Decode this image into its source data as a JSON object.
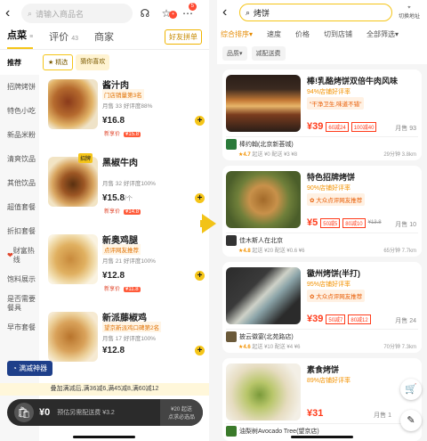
{
  "left": {
    "search_placeholder": "请输入商品名",
    "badge": "5",
    "tabs": [
      {
        "label": "点菜"
      },
      {
        "label": "评价",
        "count": "43"
      },
      {
        "label": "商家"
      }
    ],
    "friend_btn": "好友拼单",
    "chips": [
      "精选",
      "猜你喜欢"
    ],
    "sidebar": [
      "推荐",
      "招牌烤饼",
      "特色小吃",
      "新品米粉",
      "清爽饮品",
      "其他饮品",
      "超值套餐",
      "折扣套餐",
      "财富热线",
      "饱料展示",
      "是否需要餐具",
      "早市套餐"
    ],
    "items": [
      {
        "name": "酱汁肉",
        "rank": "门店销量第3名",
        "sales": "月售 33 好评度88%",
        "price": "¥16.8",
        "unit": "",
        "disc": "新享价",
        "disc_val": "¥15.8"
      },
      {
        "name": "黑椒牛肉",
        "rank": "",
        "sales": "月售 32 好评度100%",
        "price": "¥15.8",
        "unit": "/个",
        "disc": "新享价",
        "disc_val": "¥14.8",
        "tag": "招牌"
      },
      {
        "name": "新奥鸡腿",
        "rank": "点评网友推荐",
        "sales": "月售 21 好评度100%",
        "price": "¥12.8",
        "unit": "",
        "disc": "新享价",
        "disc_val": "¥11.8"
      },
      {
        "name": "新派藤椒鸡",
        "rank": "望京新派鸡口碑第2名",
        "sales": "月售 17 好评度100%",
        "price": "¥12.8",
        "unit": "",
        "disc": "",
        "disc_val": ""
      }
    ],
    "manjian": "满减神器",
    "promo": "叠加满减后,满36减6,满45减8,满60减12",
    "cart": {
      "total": "¥0",
      "fee": "预估另需配送费 ¥3.2",
      "min1": "¥20 起送",
      "min2": "点求必选品"
    }
  },
  "right": {
    "search": "烤饼",
    "switch": "切换地址",
    "filters": [
      "综合排序",
      "速度",
      "价格",
      "切到店铺",
      "全部筛选"
    ],
    "cats": [
      "品质",
      "减配送费"
    ],
    "cards": [
      {
        "title": "棒!乳酪烤饼双倍牛肉风味",
        "sub": "94%店铺好评率",
        "tag": "\"干净卫生,味道不错\"",
        "price": "¥39",
        "d1": "60减24",
        "d2": "100减40",
        "sold": "月售 93",
        "shop": "棒约翰(北京新荟城)",
        "rating": "4.7",
        "info": "起送 ¥0  配送 ¥3 ¥8",
        "dist": "29分钟  3.8km"
      },
      {
        "title": "特色招牌烤饼",
        "sub": "90%店铺好评率",
        "tag": "大众点评网友推荐",
        "price": "¥5",
        "d1": "50减5",
        "d2": "80减10",
        "old": "¥13.8",
        "sold": "月售 10",
        "shop": "佳木斯人在北京",
        "rating": "4.8",
        "info": "起送 ¥20  配送 ¥0.6 ¥6",
        "dist": "65分钟  7.7km"
      },
      {
        "title": "徽州烤饼(半打)",
        "sub": "95%店铺好评率",
        "tag": "大众点评网友推荐",
        "price": "¥39",
        "d1": "50减7",
        "d2": "80减12",
        "sold": "月售 24",
        "shop": "披云徽宴(北苑路店)",
        "rating": "4.6",
        "info": "起送 ¥10  配送 ¥4 ¥6",
        "dist": "70分钟  7.3km"
      },
      {
        "title": "素食烤饼",
        "sub": "89%店铺好评率",
        "tag": "",
        "price": "¥31",
        "d1": "",
        "d2": "",
        "sold": "月售 1",
        "shop": "油梨树Avocado Tree(望京店)",
        "rating": "4.7",
        "info": "",
        "dist": ""
      }
    ]
  },
  "colors": {
    "brand": "#f5c518",
    "accent": "#ff3b1a"
  }
}
